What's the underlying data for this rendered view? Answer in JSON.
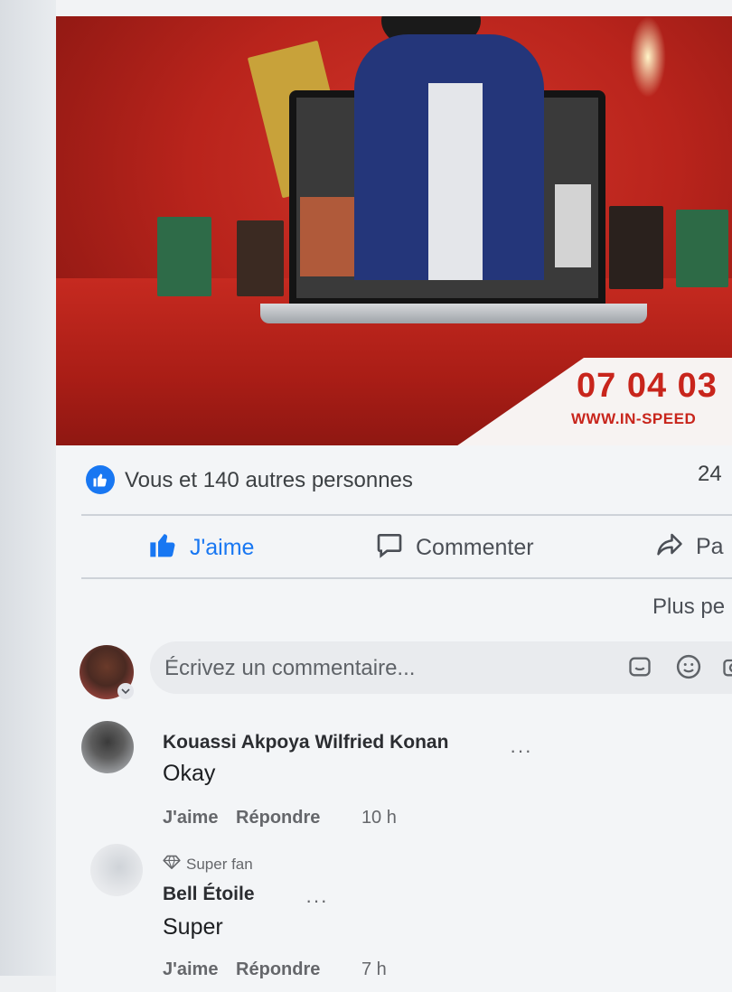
{
  "post": {
    "image": {
      "phone": "07 04 03",
      "url": "WWW.IN-SPEED"
    },
    "reactions": {
      "text": "Vous et 140 autres personnes",
      "count": "24"
    },
    "actions": {
      "like": "J'aime",
      "comment": "Commenter",
      "share": "Pa"
    },
    "sort_label": "Plus pe"
  },
  "composer": {
    "placeholder": "Écrivez un commentaire..."
  },
  "comments": [
    {
      "author": "Kouassi Akpoya Wilfried Konan",
      "text": "Okay",
      "like": "J'aime",
      "reply": "Répondre",
      "time": "10 h",
      "more": "···"
    },
    {
      "badge": "Super fan",
      "author": "Bell Étoile",
      "text": "Super",
      "like": "J'aime",
      "reply": "Répondre",
      "time": "7 h",
      "more": "···"
    }
  ],
  "colors": {
    "accent": "#1877f2",
    "banner_red": "#c8251c",
    "background": "#f3f5f7"
  },
  "icons": [
    "like-icon",
    "comment-icon",
    "share-icon",
    "gif-icon",
    "emoji-icon",
    "camera-icon",
    "diamond-icon",
    "chevron-down-icon"
  ]
}
